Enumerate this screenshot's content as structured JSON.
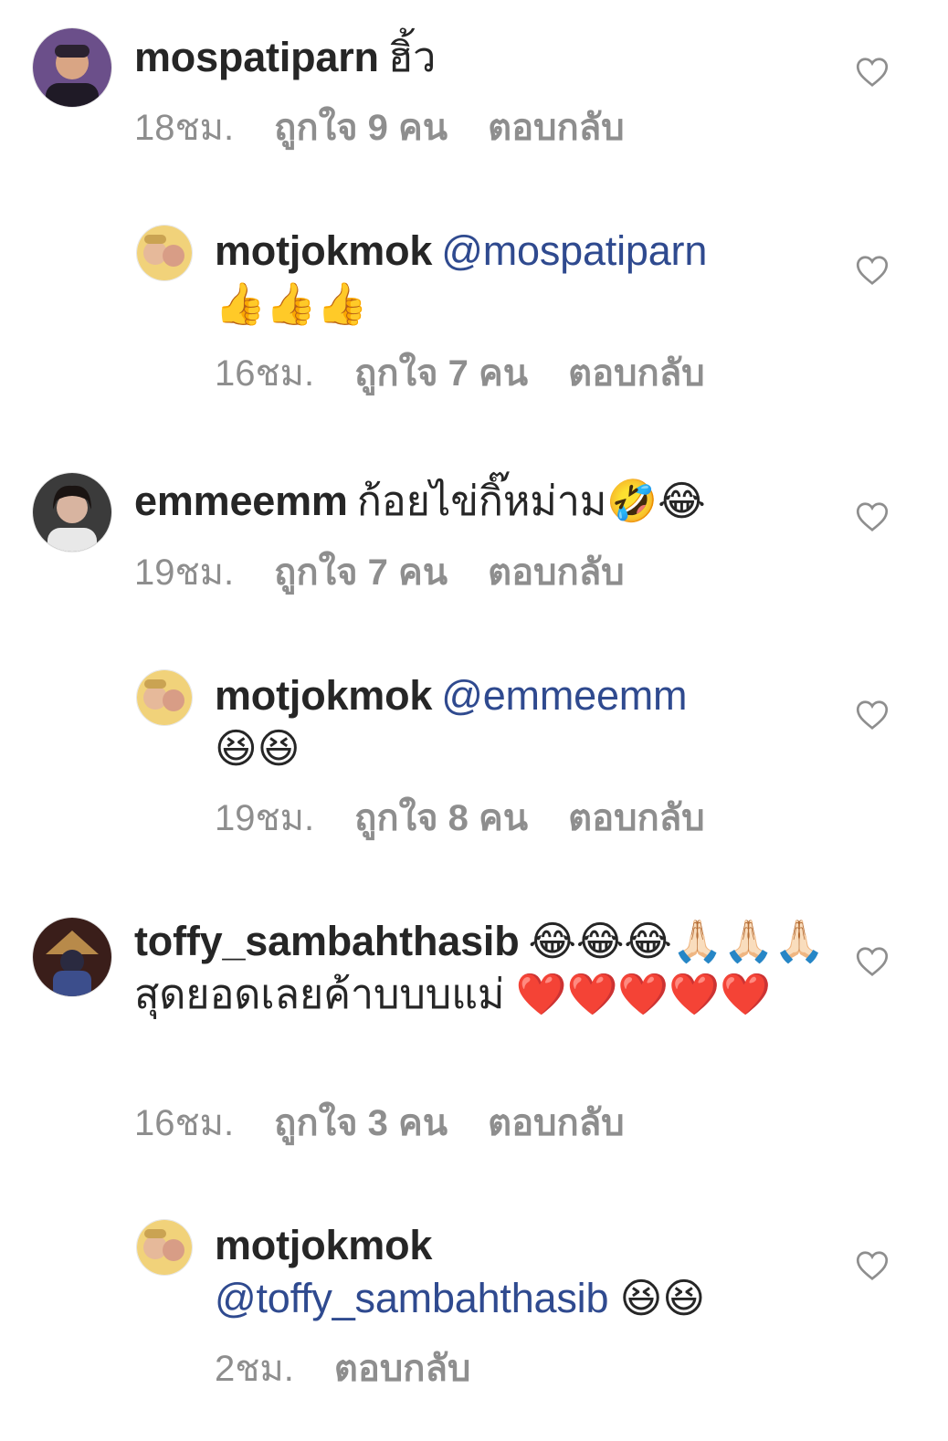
{
  "comments": [
    {
      "username": "mospatiparn",
      "mention": "",
      "text": "ฮิ้ว",
      "time": "18ชม.",
      "likes": "ถูกใจ 9 คน",
      "reply": "ตอบกลับ"
    },
    {
      "username": "motjokmok",
      "mention": "@mospatiparn",
      "text": "👍👍👍",
      "time": "16ชม.",
      "likes": "ถูกใจ 7 คน",
      "reply": "ตอบกลับ"
    },
    {
      "username": "emmeemm",
      "mention": "",
      "text": "ก้อยไข่กิ๊หม่าม🤣😂",
      "time": "19ชม.",
      "likes": "ถูกใจ 7 คน",
      "reply": "ตอบกลับ"
    },
    {
      "username": "motjokmok",
      "mention": "@emmeemm",
      "text": "😆😆",
      "time": "19ชม.",
      "likes": "ถูกใจ 8 คน",
      "reply": "ตอบกลับ"
    },
    {
      "username": "toffy_sambahthasib",
      "mention": "",
      "text": "😂😂😂🙏🏻🙏🏻🙏🏻 สุดยอดเลยค้าบบบแม่ ❤️❤️❤️❤️❤️",
      "time": "16ชม.",
      "likes": "ถูกใจ 3 คน",
      "reply": "ตอบกลับ"
    },
    {
      "username": "motjokmok",
      "mention": "@toffy_sambahthasib",
      "text": "😆😆",
      "time": "2ชม.",
      "likes": "",
      "reply": "ตอบกลับ"
    }
  ],
  "icons": {
    "like": "heart-outline-icon"
  },
  "colors": {
    "mention": "#2f4a8f",
    "meta": "#8e8e8e",
    "text": "#262626"
  }
}
